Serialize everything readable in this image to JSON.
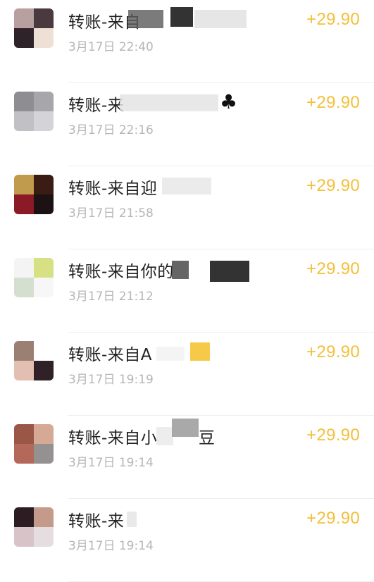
{
  "transactions": [
    {
      "title": "转账-来自",
      "time": "3月17日 22:40",
      "amount": "+29.90",
      "avatar_colors": [
        "#b8a0a0",
        "#4a3a3f",
        "#2e2328",
        "#efe0d6"
      ]
    },
    {
      "title": "转账-来",
      "time": "3月17日 22:16",
      "amount": "+29.90",
      "avatar_colors": [
        "#8e8e92",
        "#a7a7ab",
        "#c1c1c5",
        "#d4d4d8"
      ],
      "trailing_text": "♣"
    },
    {
      "title": "转账-来自迎",
      "time": "3月17日 21:58",
      "amount": "+29.90",
      "avatar_colors": [
        "#c09a4d",
        "#3b1c14",
        "#8b1a26",
        "#1c1214"
      ]
    },
    {
      "title": "转账-来自你的",
      "time": "3月17日 21:12",
      "amount": "+29.90",
      "avatar_colors": [
        "#f4f4f4",
        "#d7e183",
        "#d5dfcf",
        "#f7f7f7"
      ]
    },
    {
      "title": "转账-来自A",
      "time": "3月17日 19:19",
      "amount": "+29.90",
      "avatar_colors": [
        "#9c7f73",
        "#ffffff",
        "#e2bfb0",
        "#2f2127"
      ]
    },
    {
      "title": "转账-来自小",
      "time": "3月17日 19:14",
      "amount": "+29.90",
      "avatar_colors": [
        "#9a5746",
        "#d6a896",
        "#b4685a",
        "#959191"
      ],
      "trailing_text": "豆"
    },
    {
      "title": "转账-来",
      "time": "3月17日 19:14",
      "amount": "+29.90",
      "avatar_colors": [
        "#2c1d22",
        "#c49b8a",
        "#d8c4c8",
        "#e6dde0"
      ]
    }
  ]
}
